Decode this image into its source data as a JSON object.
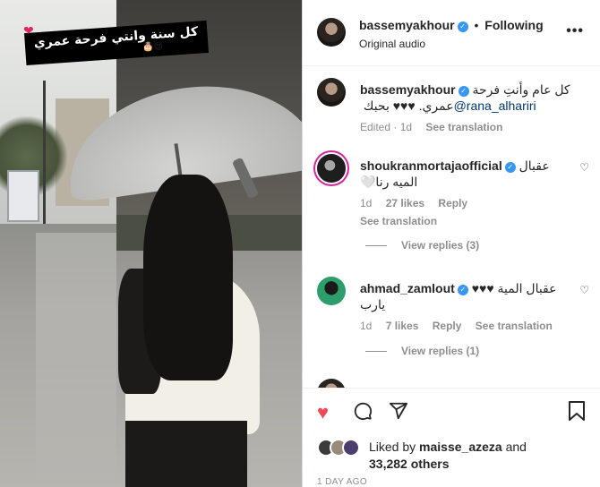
{
  "media": {
    "caption_overlay": "كل سنة وانتي فرحة عمري",
    "heart_sticker": "❤",
    "emoji_sticker": "🎂😍"
  },
  "header": {
    "username": "bassemyakhour",
    "separator": "•",
    "follow_status": "Following",
    "subtitle": "Original audio",
    "more": "•••"
  },
  "caption": {
    "username": "bassemyakhour",
    "text_before": "كل عام وأنتِ فرحة عمري. ♥♥♥ بحبك ",
    "mention": "@rana_alhariri",
    "meta_edited": "Edited · 1d",
    "see_translation": "See translation"
  },
  "comments": [
    {
      "username": "shoukranmortajaofficial",
      "text": "عقبال الميه رنا🤍",
      "time": "1d",
      "likes": "27 likes",
      "reply": "Reply",
      "see_translation": "See translation",
      "view_replies": "View replies (3)"
    },
    {
      "username": "ahmad_zamlout",
      "text": "عقبال المية ♥♥♥ يارب",
      "time": "1d",
      "likes": "7 likes",
      "reply": "Reply",
      "see_translation": "See translation",
      "view_replies": "View replies (1)"
    }
  ],
  "actions": {
    "liked_by_prefix": "Liked by",
    "liked_by_user": "maisse_azeza",
    "liked_by_and": "and",
    "others": "33,282 others",
    "timestamp": "1 DAY AGO"
  },
  "icons": {
    "heart": "heart-icon",
    "comment": "comment-icon",
    "share": "share-icon",
    "save": "bookmark-icon",
    "verified": "verified-badge-icon"
  },
  "colors": {
    "like": "#ed4956",
    "verified": "#3897f0",
    "link": "#00376b",
    "muted": "#8e8e8e"
  }
}
